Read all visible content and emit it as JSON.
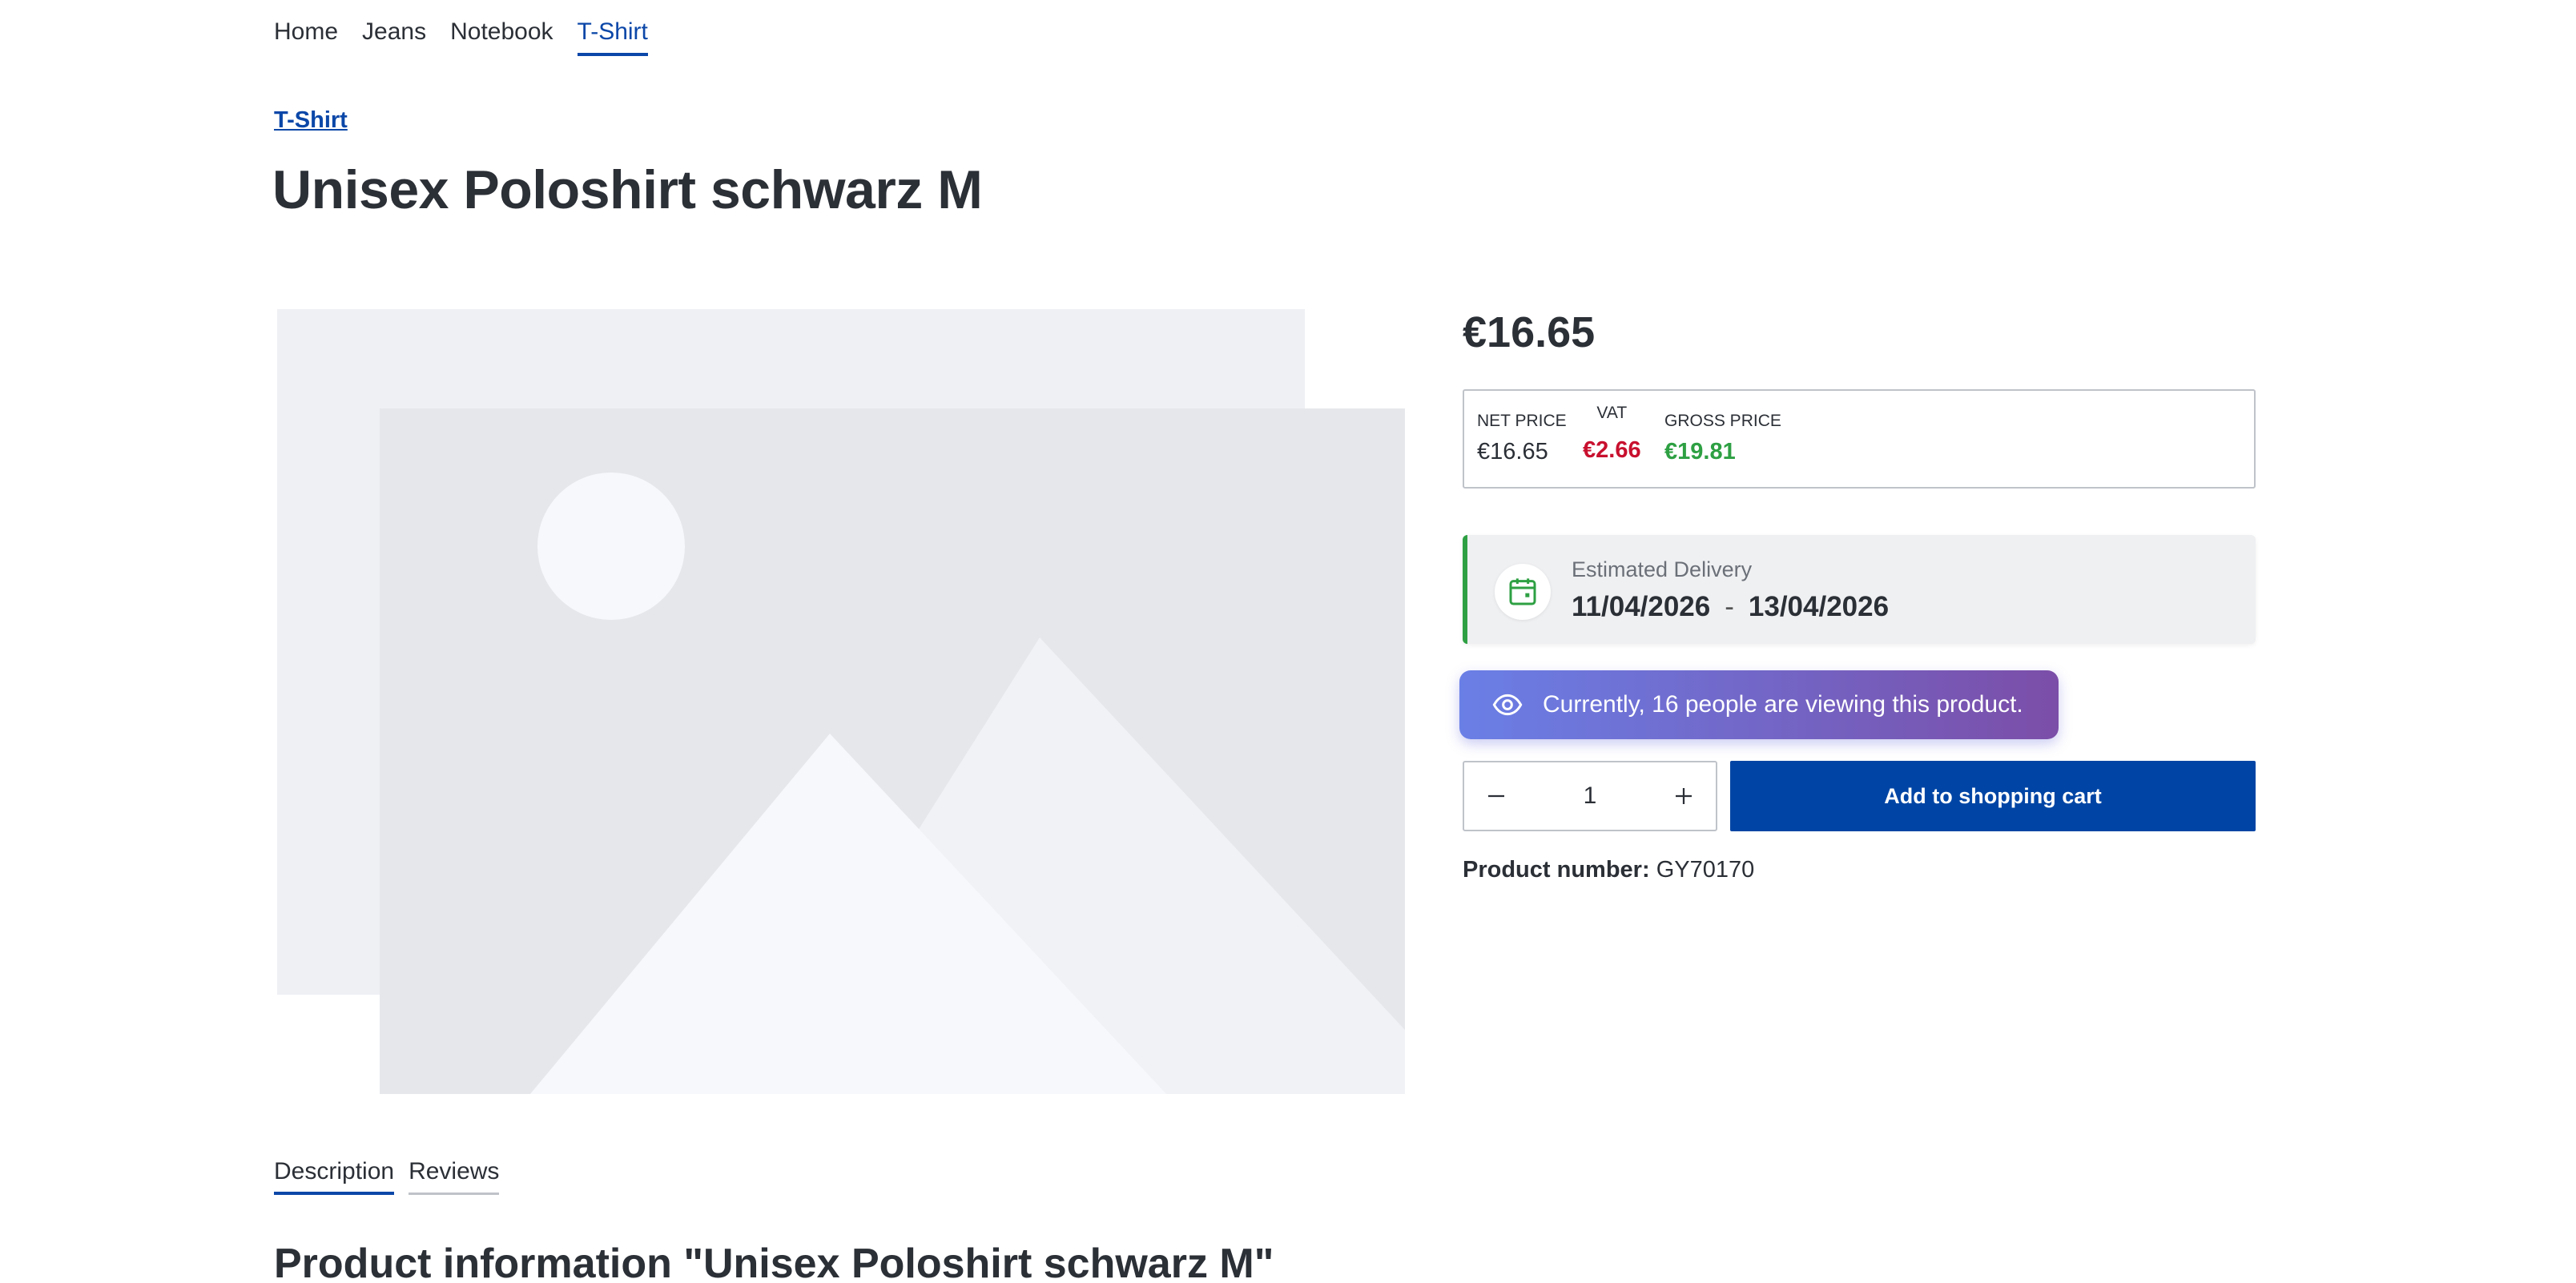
{
  "nav": {
    "items": [
      "Home",
      "Jeans",
      "Notebook",
      "T-Shirt"
    ],
    "active": "T-Shirt"
  },
  "breadcrumb": {
    "category": "T-Shirt"
  },
  "product": {
    "title": "Unisex Poloshirt schwarz M",
    "price": "€16.65",
    "net_label": "NET PRICE",
    "net_value": "€16.65",
    "vat_label": "VAT",
    "vat_value": "€2.66",
    "gross_label": "GROSS PRICE",
    "gross_value": "€19.81",
    "number_label": "Product number:",
    "number_value": "GY70170"
  },
  "delivery": {
    "label": "Estimated Delivery",
    "from": "11/04/2026",
    "separator": "-",
    "to": "13/04/2026"
  },
  "viewing": {
    "text": "Currently, 16 people are viewing this product."
  },
  "cart": {
    "quantity": "1",
    "add_label": "Add to shopping cart"
  },
  "tabs": {
    "description": "Description",
    "reviews": "Reviews"
  },
  "info": {
    "heading": "Product information \"Unisex Poloshirt schwarz M\""
  },
  "colors": {
    "accent": "#0b47a8",
    "cart_button": "#0045a5",
    "vat": "#c8102e",
    "gross": "#2ea043",
    "viewing_gradient_start": "#6a7fe6",
    "viewing_gradient_end": "#7b4ea8"
  },
  "icons": {
    "calendar": "calendar-icon",
    "eye": "eye-icon",
    "minus": "minus-icon",
    "plus": "plus-icon",
    "image_placeholder": "image-placeholder-icon"
  }
}
